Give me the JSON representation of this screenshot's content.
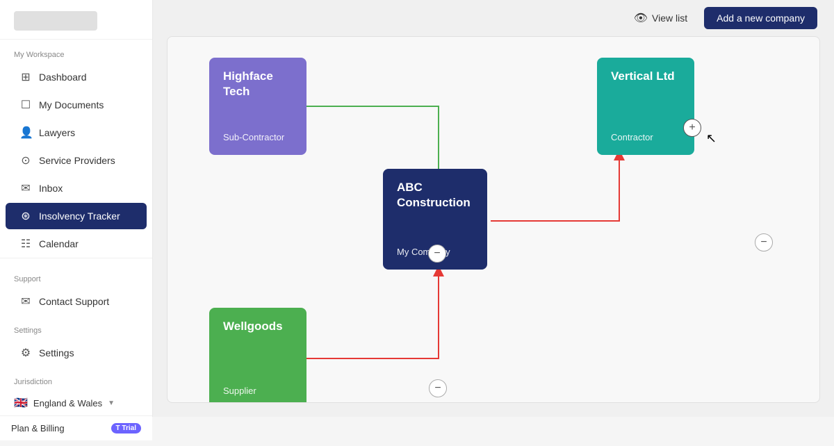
{
  "sidebar": {
    "workspace_label": "My Workspace",
    "items": [
      {
        "id": "dashboard",
        "label": "Dashboard",
        "icon": "⊞",
        "active": false
      },
      {
        "id": "my-documents",
        "label": "My Documents",
        "icon": "☐",
        "active": false
      },
      {
        "id": "lawyers",
        "label": "Lawyers",
        "icon": "👤",
        "active": false
      },
      {
        "id": "service-providers",
        "label": "Service Providers",
        "icon": "⊙",
        "active": false
      },
      {
        "id": "inbox",
        "label": "Inbox",
        "icon": "✉",
        "active": false
      },
      {
        "id": "insolvency-tracker",
        "label": "Insolvency Tracker",
        "icon": "⊛",
        "active": true
      },
      {
        "id": "calendar",
        "label": "Calendar",
        "icon": "☷",
        "active": false
      }
    ],
    "support_label": "Support",
    "support_items": [
      {
        "id": "contact-support",
        "label": "Contact Support",
        "icon": "✉"
      }
    ],
    "settings_label": "Settings",
    "settings_items": [
      {
        "id": "settings",
        "label": "Settings",
        "icon": "⚙"
      }
    ],
    "jurisdiction_label": "Jurisdiction",
    "jurisdiction_value": "England & Wales",
    "plan_label": "Plan & Billing",
    "trial_badge": "T Trial"
  },
  "topbar": {
    "view_list_label": "View list",
    "add_company_label": "Add a new company"
  },
  "diagram": {
    "nodes": [
      {
        "id": "highface",
        "title": "Highface Tech",
        "role": "Sub-Contractor",
        "color": "#7c6fcd"
      },
      {
        "id": "vertical",
        "title": "Vertical Ltd",
        "role": "Contractor",
        "color": "#1aab9b"
      },
      {
        "id": "abc",
        "title": "ABC Construction",
        "role": "My Company",
        "color": "#1e2d6b"
      },
      {
        "id": "wellgoods",
        "title": "Wellgoods",
        "role": "Supplier",
        "color": "#4caf50"
      }
    ],
    "add_button_label": "+",
    "minus_button_label": "−"
  }
}
